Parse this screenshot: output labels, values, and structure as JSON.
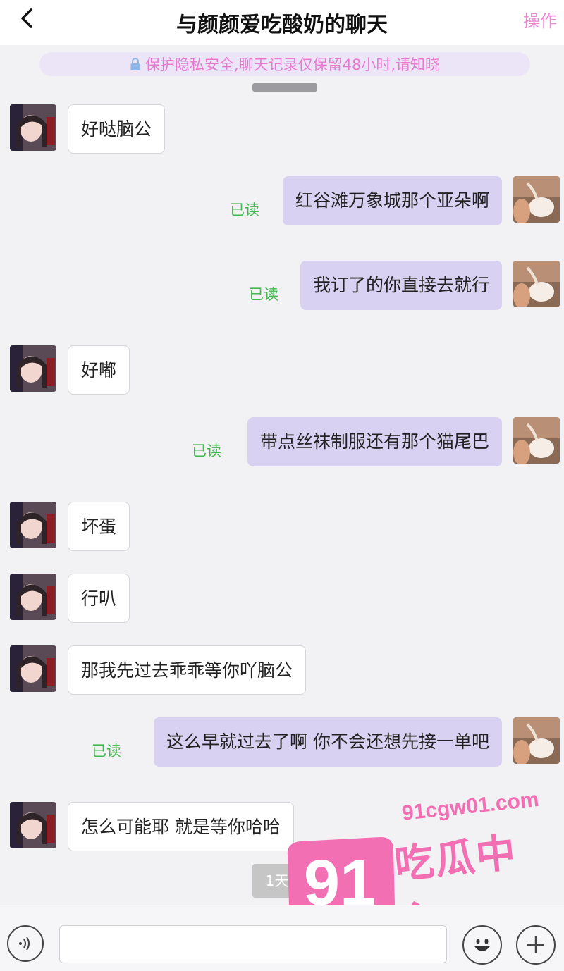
{
  "header": {
    "title": "与颜颜爱吃酸奶的聊天",
    "action_label": "操作"
  },
  "notice": {
    "text": "保护隐私安全,聊天记录仅保留48小时,请知晓"
  },
  "messages": [
    {
      "side": "in",
      "text": "好哒脑公"
    },
    {
      "side": "out",
      "text": "红谷滩万象城那个亚朵啊",
      "status": "已读"
    },
    {
      "side": "out",
      "text": "我订了的你直接去就行",
      "status": "已读"
    },
    {
      "side": "in",
      "text": "好嘟"
    },
    {
      "side": "out",
      "text": "带点丝袜制服还有那个猫尾巴",
      "status": "已读"
    },
    {
      "side": "in",
      "text": "坏蛋"
    },
    {
      "side": "in",
      "text": "行叭"
    },
    {
      "side": "in",
      "text": "那我先过去乖乖等你吖脑公"
    },
    {
      "side": "out",
      "text": "这么早就过去了啊 你不会还想先接一单吧",
      "status": "已读"
    },
    {
      "side": "in",
      "text": "怎么可能耶 就是等你哈哈"
    }
  ],
  "time_divider": "1天前",
  "composer": {
    "input_value": "",
    "voice_icon": "voice-icon",
    "emoji_icon": "emoji-icon",
    "plus_icon": "plus-icon"
  },
  "watermark": {
    "number": "91",
    "url": "91cgw01.com",
    "name": "吃瓜中心"
  },
  "colors": {
    "accent_pink": "#e98ad0",
    "read_green": "#43b84e",
    "out_bubble": "#d8d1f1",
    "watermark_pink": "#f36fb3"
  }
}
